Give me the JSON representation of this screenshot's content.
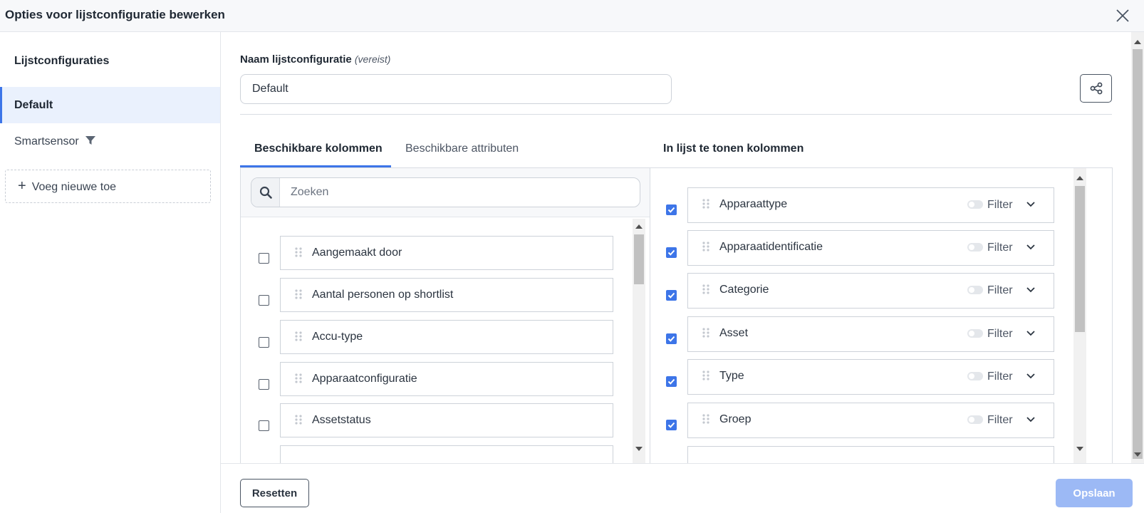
{
  "dialog": {
    "title": "Opties voor lijstconfiguratie bewerken",
    "close_icon": "close-icon"
  },
  "sidebar": {
    "heading": "Lijstconfiguraties",
    "items": [
      {
        "label": "Default",
        "active": true
      },
      {
        "label": "Smartsensor",
        "icon": "filter-icon"
      }
    ],
    "add_new": "Voeg nieuwe toe"
  },
  "form": {
    "name_label": "Naam lijstconfiguratie",
    "name_required": "(vereist)",
    "name_value": "Default",
    "share_icon": "share-icon"
  },
  "tabs": {
    "available_columns": "Beschikbare kolommen",
    "available_attributes": "Beschikbare attributen",
    "shown_columns": "In lijst te tonen kolommen"
  },
  "search": {
    "placeholder": "Zoeken",
    "value": ""
  },
  "available_columns": [
    {
      "label": "Aangemaakt door",
      "checked": false
    },
    {
      "label": "Aantal personen op shortlist",
      "checked": false
    },
    {
      "label": "Accu-type",
      "checked": false
    },
    {
      "label": "Apparaatconfiguratie",
      "checked": false
    },
    {
      "label": "Assetstatus",
      "checked": false
    }
  ],
  "shown_columns": [
    {
      "label": "Apparaattype",
      "checked": true,
      "filter_label": "Filter",
      "filter_on": false
    },
    {
      "label": "Apparaatidentificatie",
      "checked": true,
      "filter_label": "Filter",
      "filter_on": false
    },
    {
      "label": "Categorie",
      "checked": true,
      "filter_label": "Filter",
      "filter_on": false
    },
    {
      "label": "Asset",
      "checked": true,
      "filter_label": "Filter",
      "filter_on": false
    },
    {
      "label": "Type",
      "checked": true,
      "filter_label": "Filter",
      "filter_on": false
    },
    {
      "label": "Groep",
      "checked": true,
      "filter_label": "Filter",
      "filter_on": false
    }
  ],
  "footer": {
    "reset_label": "Resetten",
    "save_label": "Opslaan"
  },
  "colors": {
    "accent": "#3d75e8",
    "active_bg": "#eaf1fd",
    "save_disabled": "#9cb9f5"
  }
}
